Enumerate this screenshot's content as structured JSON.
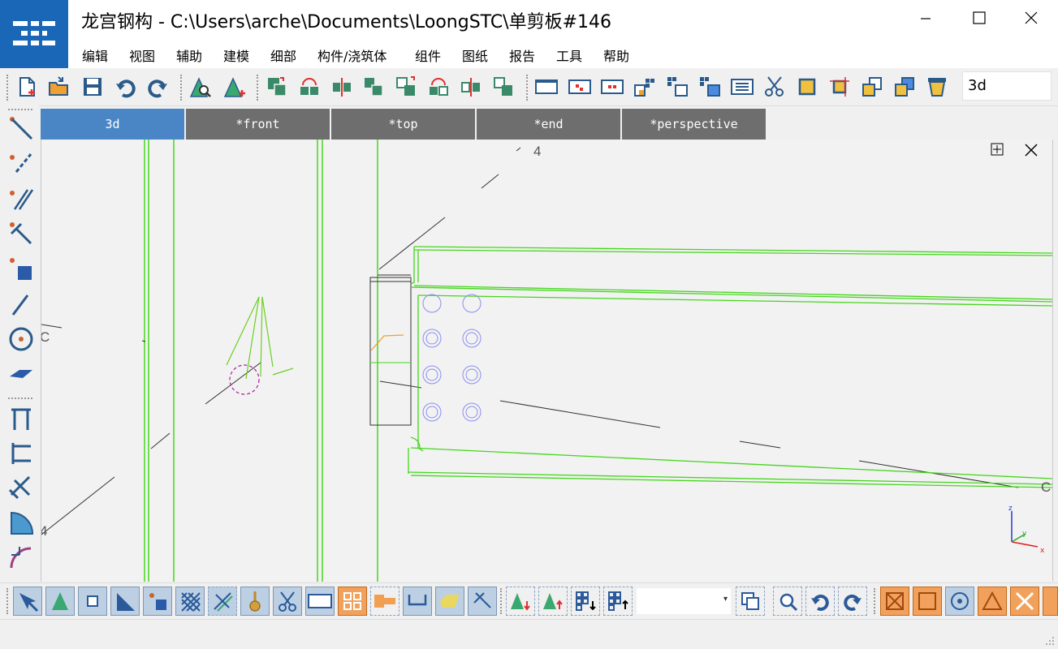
{
  "window": {
    "title": "龙宫钢构 - C:\\Users\\arche\\Documents\\LoongSTC\\单剪板#146",
    "minimize_icon": "minimize-icon",
    "maximize_icon": "maximize-icon",
    "close_icon": "close-icon"
  },
  "menu": [
    "编辑",
    "视图",
    "辅助",
    "建模",
    "细部",
    "构件/浇筑体",
    "组件",
    "图纸",
    "报告",
    "工具",
    "帮助"
  ],
  "toolbar": {
    "view_name": "3d",
    "buttons": [
      "new-file-icon",
      "open-folder-icon",
      "save-icon",
      "undo-icon",
      "redo-icon",
      "inspect-object-icon",
      "add-point-icon",
      "copy-icon",
      "copy-special-icon",
      "mirror-icon",
      "move-icon",
      "move-special-icon",
      "rotate-icon",
      "mirror-special-icon",
      "align-icon",
      "view-window-icon",
      "view-grid-icon",
      "view-points-icon",
      "group-icon",
      "group-select-icon",
      "group-move-icon",
      "list-icon",
      "cut-icon",
      "part-icon",
      "fit-part-icon",
      "combine-icon",
      "merge-icon",
      "bucket-icon"
    ]
  },
  "left_toolbar": [
    "beam-icon",
    "polybeam-icon",
    "twin-beam-icon",
    "column-icon",
    "pad-footing-icon",
    "line-icon",
    "circle-icon",
    "plate-icon",
    "portal-frame-icon",
    "frame-icon",
    "brace-icon",
    "polygon-plate-icon",
    "curved-beam-icon"
  ],
  "tabs": [
    {
      "label": "3d",
      "active": true
    },
    {
      "label": "*front",
      "active": false
    },
    {
      "label": "*top",
      "active": false
    },
    {
      "label": "*end",
      "active": false
    },
    {
      "label": "*perspective",
      "active": false
    }
  ],
  "viewport": {
    "labels": {
      "grid_4_top": "4",
      "grid_c_left": "C",
      "grid_c_right": "C",
      "grid_4_bottom": "4"
    },
    "axis": {
      "z": "z",
      "y": "y",
      "x": "x"
    },
    "colors": {
      "member": "#44d61c",
      "bolt": "#8a8ff0",
      "line": "#333333",
      "orange": "#f0a030",
      "magenta": "#a020a0"
    },
    "controls": [
      "layout-icon",
      "close-view-icon"
    ]
  },
  "bottom_toolbar": {
    "buttons": [
      "select-all-icon",
      "select-part-icon",
      "select-point-icon",
      "select-plane-icon",
      "select-component-icon",
      "select-grid-icon",
      "select-bolt-icon",
      "select-weld-icon",
      "select-cut-icon",
      "select-view-icon",
      "select-assembly-icon",
      "select-connection-icon",
      "select-surface-icon",
      "select-polygon-icon",
      "select-reference-icon",
      "lower-plane-icon",
      "upper-plane-icon",
      "grid-down-icon",
      "grid-up-icon"
    ],
    "combo_value": "",
    "right_buttons": [
      "copy-view-icon",
      "zoom-window-icon",
      "undo-view-icon",
      "redo-view-icon"
    ],
    "snap_buttons": [
      "snap-end-icon",
      "snap-square-icon",
      "snap-center-icon",
      "snap-triangle-icon",
      "snap-intersect-icon",
      "snap-extra-icon"
    ]
  }
}
